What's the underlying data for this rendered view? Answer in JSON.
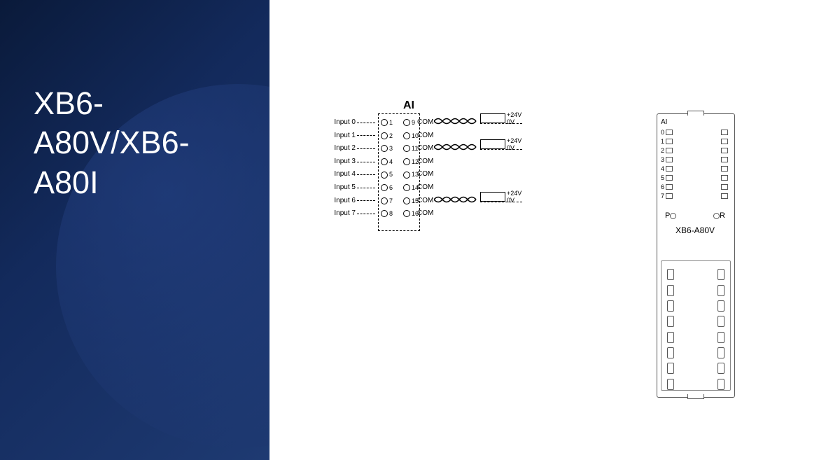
{
  "title": "XB6-A80V/XB6-A80I",
  "wiring": {
    "header": "AI",
    "inputs": [
      "Input 0",
      "Input 1",
      "Input 2",
      "Input 3",
      "Input 4",
      "Input 5",
      "Input 6",
      "Input 7"
    ],
    "left_terminals": [
      "1",
      "2",
      "3",
      "4",
      "5",
      "6",
      "7",
      "8"
    ],
    "right_terminals": [
      "9",
      "10",
      "11",
      "12",
      "13",
      "14",
      "15",
      "16"
    ],
    "right_labels": [
      "COM",
      "COM",
      "COM",
      "COM",
      "COM",
      "COM",
      "COM",
      "COM"
    ],
    "psu_plus": "+24V",
    "psu_minus": "0V"
  },
  "module": {
    "ai_label": "AI",
    "channels": [
      "0",
      "1",
      "2",
      "3",
      "4",
      "5",
      "6",
      "7"
    ],
    "p_label": "P",
    "r_label": "R",
    "model": "XB6-A80V"
  }
}
